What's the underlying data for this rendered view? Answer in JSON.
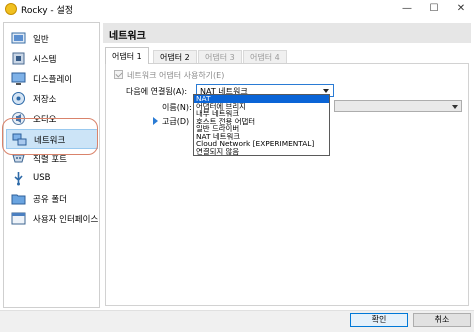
{
  "window": {
    "title": "Rocky - 설정",
    "minimize_glyph": "—",
    "maximize_glyph": "☐",
    "close_glyph": "✕"
  },
  "sidebar": {
    "items": [
      {
        "label": "일반",
        "icon": "general-icon"
      },
      {
        "label": "시스템",
        "icon": "system-icon"
      },
      {
        "label": "디스플레이",
        "icon": "display-icon"
      },
      {
        "label": "저장소",
        "icon": "storage-icon"
      },
      {
        "label": "오디오",
        "icon": "audio-icon"
      },
      {
        "label": "네트워크",
        "icon": "network-icon",
        "selected": true
      },
      {
        "label": "직렬 포트",
        "icon": "serial-port-icon"
      },
      {
        "label": "USB",
        "icon": "usb-icon"
      },
      {
        "label": "공유 폴더",
        "icon": "shared-folder-icon"
      },
      {
        "label": "사용자 인터페이스",
        "icon": "user-interface-icon"
      }
    ]
  },
  "main": {
    "section_title": "네트워크",
    "tabs": [
      {
        "label": "어댑터 1",
        "active": true
      },
      {
        "label": "어댑터 2"
      },
      {
        "label": "어댑터 3"
      },
      {
        "label": "어댑터 4"
      }
    ],
    "enable_adapter_label": "네트워크 어댑터 사용하기(E)",
    "attached_to_label": "다음에 연결됨(A):",
    "attached_to_value": "NAT 네트워크",
    "name_label": "이름(N):",
    "advanced_label": "고급(D)",
    "dropdown_options": [
      {
        "label": "NAT",
        "selected": true
      },
      {
        "label": "어댑터에 브리지"
      },
      {
        "label": "내부 네트워크"
      },
      {
        "label": "호스트 전용 어댑터"
      },
      {
        "label": "일반 드라이버"
      },
      {
        "label": "NAT 네트워크"
      },
      {
        "label": "Cloud Network [EXPERIMENTAL]"
      },
      {
        "label": "연결되지 않음"
      }
    ]
  },
  "buttons": {
    "ok": "확인",
    "cancel": "취소"
  },
  "colors": {
    "accent": "#0a64d6",
    "highlight_ring": "#d9836b",
    "selected_sidebar": "#cce4f7"
  }
}
